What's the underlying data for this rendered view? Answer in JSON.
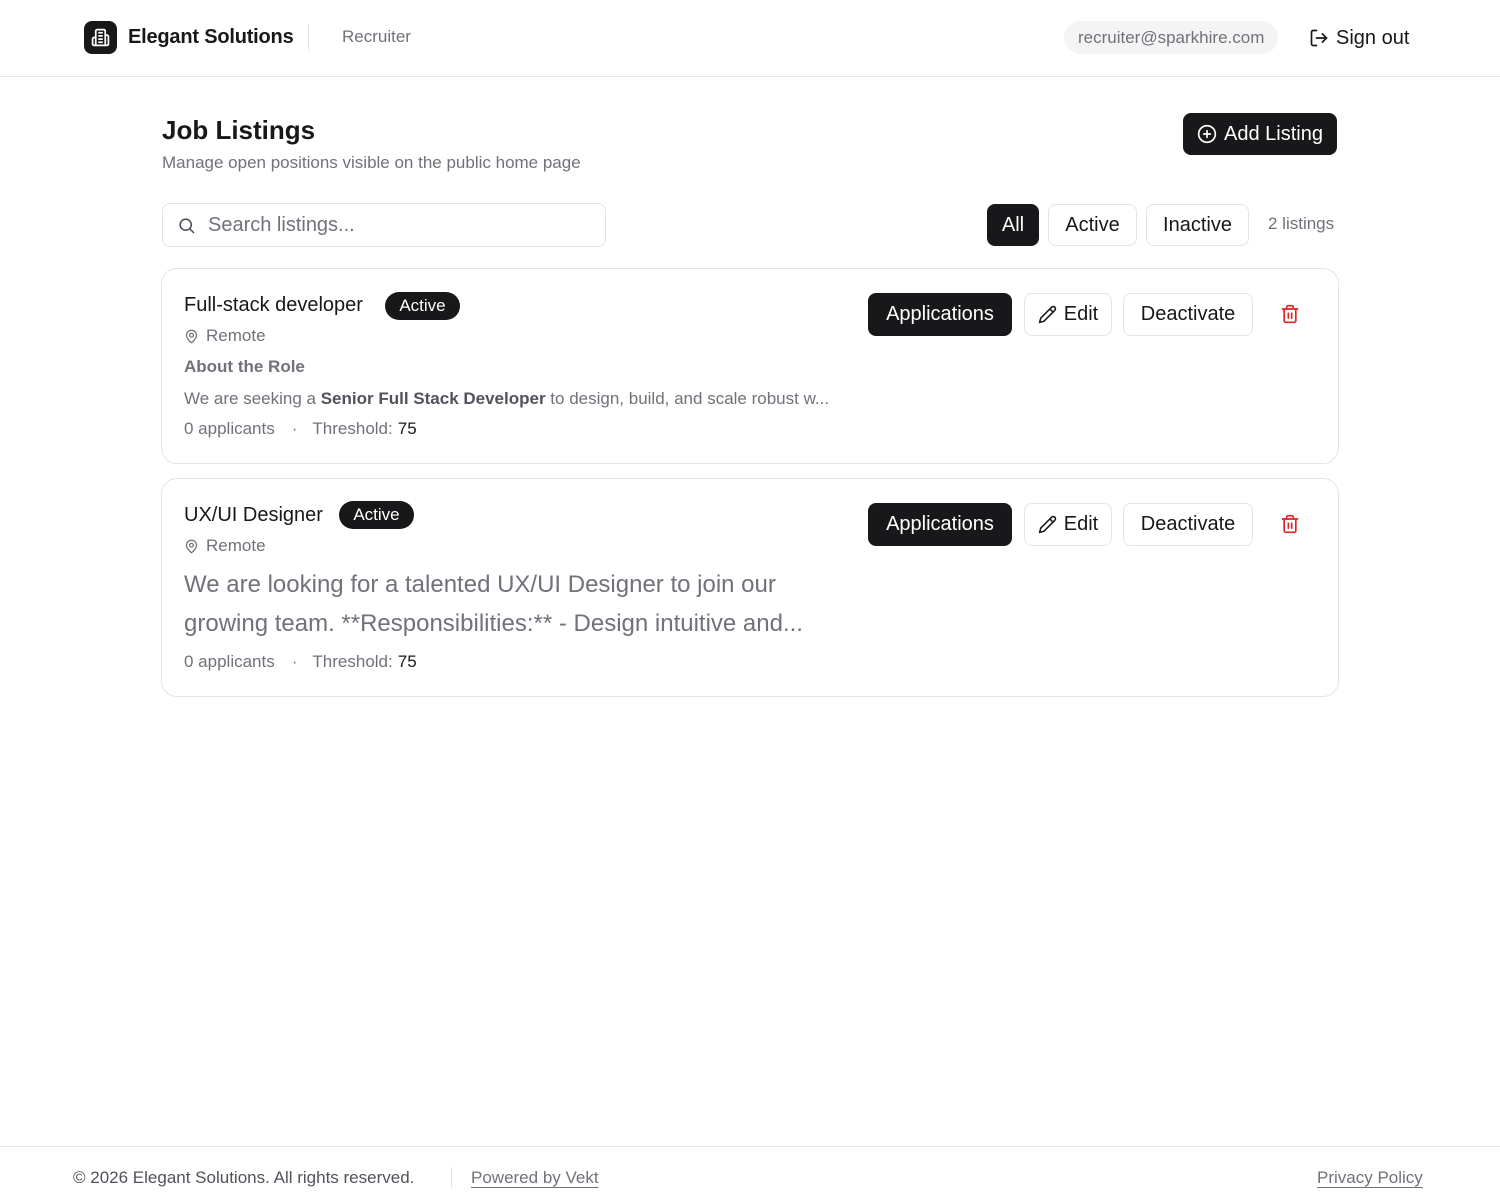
{
  "header": {
    "brand_name": "Elegant Solutions",
    "role_label": "Recruiter",
    "user_email": "recruiter@sparkhire.com",
    "signout_label": "Sign out"
  },
  "page": {
    "title": "Job Listings",
    "subtitle": "Manage open positions visible on the public home page",
    "add_button_label": "Add Listing"
  },
  "toolbar": {
    "search_placeholder": "Search listings...",
    "search_value": "",
    "filters": [
      {
        "label": "All",
        "selected": true
      },
      {
        "label": "Active",
        "selected": false
      },
      {
        "label": "Inactive",
        "selected": false
      }
    ],
    "count_label": "2 listings"
  },
  "listings": [
    {
      "title": "Full-stack developer",
      "status": "Active",
      "location": "Remote",
      "description_heading": "About the Role",
      "description_before": "We are seeking a ",
      "description_bold": "Senior Full Stack Developer",
      "description_after": " to design, build, and scale robust w...",
      "applicants_label": "0 applicants",
      "meta_separator": "·",
      "threshold_label": "Threshold:",
      "threshold_value": "75",
      "applications_label": "Applications",
      "edit_label": "Edit",
      "deactivate_label": "Deactivate"
    },
    {
      "title": "UX/UI Designer",
      "status": "Active",
      "location": "Remote",
      "description": "We are looking for a talented UX/UI Designer to join our growing team. **Responsibilities:** - Design intuitive and...",
      "applicants_label": "0 applicants",
      "meta_separator": "·",
      "threshold_label": "Threshold:",
      "threshold_value": "75",
      "applications_label": "Applications",
      "edit_label": "Edit",
      "deactivate_label": "Deactivate"
    }
  ],
  "footer": {
    "copyright": "© 2026 Elegant Solutions. All rights reserved.",
    "powered_by": "Powered by Vekt",
    "privacy_label": "Privacy Policy"
  },
  "colors": {
    "primary": "#18181b",
    "muted_text": "#71717a",
    "border": "#e4e4e7",
    "danger": "#dc2626"
  }
}
